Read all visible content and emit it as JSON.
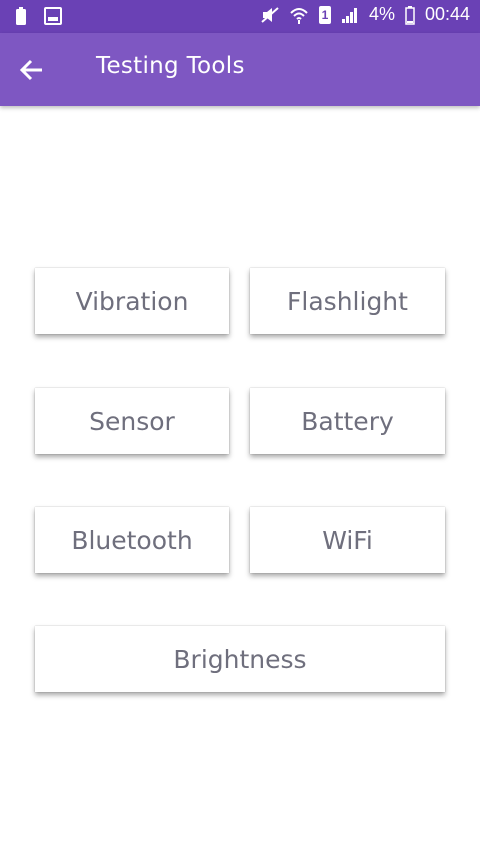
{
  "status_bar": {
    "battery_percent": "4%",
    "time": "00:44",
    "sim_label": "1"
  },
  "app_bar": {
    "title": "Testing Tools"
  },
  "buttons": [
    {
      "label": "Vibration"
    },
    {
      "label": "Flashlight"
    },
    {
      "label": "Sensor"
    },
    {
      "label": "Battery"
    },
    {
      "label": "Bluetooth"
    },
    {
      "label": "WiFi"
    },
    {
      "label": "Brightness"
    }
  ],
  "colors": {
    "status_bar": "#6a41b5",
    "app_bar": "#7e57c2",
    "button_text": "#6f6f7d"
  }
}
